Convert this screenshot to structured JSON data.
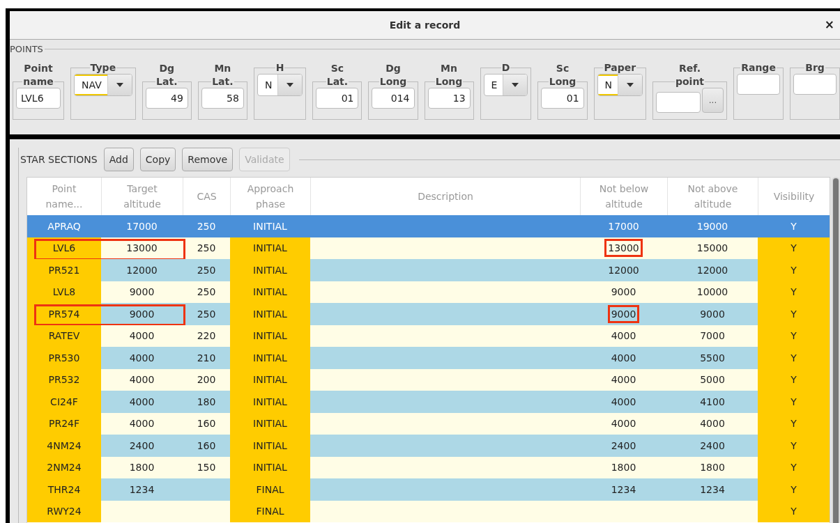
{
  "window": {
    "title": "Edit a record",
    "close": "×"
  },
  "points": {
    "title": "POINTS",
    "fields": [
      {
        "label_lines": [
          "Point",
          "name"
        ],
        "kind": "text",
        "value": "LVL6"
      },
      {
        "label_lines": [
          "Type"
        ],
        "kind": "combo",
        "value": "NAV",
        "highlighted": true
      },
      {
        "label_lines": [
          "Dg",
          "Lat."
        ],
        "kind": "number",
        "value": "49"
      },
      {
        "label_lines": [
          "Mn",
          "Lat."
        ],
        "kind": "number",
        "value": "58"
      },
      {
        "label_lines": [
          "H"
        ],
        "kind": "combo",
        "value": "N",
        "highlighted": false
      },
      {
        "label_lines": [
          "Sc",
          "Lat."
        ],
        "kind": "number",
        "value": "01"
      },
      {
        "label_lines": [
          "Dg",
          "Long"
        ],
        "kind": "number",
        "value": "014"
      },
      {
        "label_lines": [
          "Mn",
          "Long"
        ],
        "kind": "number",
        "value": "13"
      },
      {
        "label_lines": [
          "D"
        ],
        "kind": "combo",
        "value": "E",
        "highlighted": false
      },
      {
        "label_lines": [
          "Sc",
          "Long"
        ],
        "kind": "number",
        "value": "01"
      },
      {
        "label_lines": [
          "Paper"
        ],
        "kind": "combo",
        "value": "N",
        "highlighted": true
      },
      {
        "label_lines": [
          "Ref.",
          "point"
        ],
        "kind": "picker",
        "button": "..."
      },
      {
        "label_lines": [
          "Range"
        ],
        "kind": "number"
      },
      {
        "label_lines": [
          "Brg"
        ],
        "kind": "number"
      }
    ]
  },
  "star_sections": {
    "title": "STAR SECTIONS",
    "buttons": [
      {
        "label": "Add",
        "disabled": false
      },
      {
        "label": "Copy",
        "disabled": false
      },
      {
        "label": "Remove",
        "disabled": false
      },
      {
        "label": "Validate",
        "disabled": true
      }
    ],
    "table": {
      "columns": [
        [
          "Point",
          "name..."
        ],
        [
          "Target",
          "altitude"
        ],
        [
          "CAS"
        ],
        [
          "Approach",
          "phase"
        ],
        [
          "Description"
        ],
        [
          "Not below",
          "altitude"
        ],
        [
          "Not above",
          "altitude"
        ],
        [
          "Visibility"
        ]
      ],
      "rows": [
        {
          "name": "APRAQ",
          "target": "17000",
          "cas": "250",
          "phase": "INITIAL",
          "not_below": "17000",
          "not_above": "19000",
          "visibility": "Y",
          "selected": true,
          "highlighted": false
        },
        {
          "name": "LVL6",
          "target": "13000",
          "cas": "250",
          "phase": "INITIAL",
          "not_below": "13000",
          "not_above": "15000",
          "visibility": "Y",
          "selected": false,
          "highlighted": true
        },
        {
          "name": "PR521",
          "target": "12000",
          "cas": "250",
          "phase": "INITIAL",
          "not_below": "12000",
          "not_above": "12000",
          "visibility": "Y",
          "selected": false,
          "highlighted": false
        },
        {
          "name": "LVL8",
          "target": "9000",
          "cas": "250",
          "phase": "INITIAL",
          "not_below": "9000",
          "not_above": "10000",
          "visibility": "Y",
          "selected": false,
          "highlighted": false
        },
        {
          "name": "PR574",
          "target": "9000",
          "cas": "250",
          "phase": "INITIAL",
          "not_below": "9000",
          "not_above": "9000",
          "visibility": "Y",
          "selected": false,
          "highlighted": true
        },
        {
          "name": "RATEV",
          "target": "4000",
          "cas": "220",
          "phase": "INITIAL",
          "not_below": "4000",
          "not_above": "7000",
          "visibility": "Y",
          "selected": false,
          "highlighted": false
        },
        {
          "name": "PR530",
          "target": "4000",
          "cas": "210",
          "phase": "INITIAL",
          "not_below": "4000",
          "not_above": "5500",
          "visibility": "Y",
          "selected": false,
          "highlighted": false
        },
        {
          "name": "PR532",
          "target": "4000",
          "cas": "200",
          "phase": "INITIAL",
          "not_below": "4000",
          "not_above": "5000",
          "visibility": "Y",
          "selected": false,
          "highlighted": false
        },
        {
          "name": "CI24F",
          "target": "4000",
          "cas": "180",
          "phase": "INITIAL",
          "not_below": "4000",
          "not_above": "4100",
          "visibility": "Y",
          "selected": false,
          "highlighted": false
        },
        {
          "name": "PR24F",
          "target": "4000",
          "cas": "160",
          "phase": "INITIAL",
          "not_below": "4000",
          "not_above": "4000",
          "visibility": "Y",
          "selected": false,
          "highlighted": false
        },
        {
          "name": "4NM24",
          "target": "2400",
          "cas": "160",
          "phase": "INITIAL",
          "not_below": "2400",
          "not_above": "2400",
          "visibility": "Y",
          "selected": false,
          "highlighted": false
        },
        {
          "name": "2NM24",
          "target": "1800",
          "cas": "150",
          "phase": "INITIAL",
          "not_below": "1800",
          "not_above": "1800",
          "visibility": "Y",
          "selected": false,
          "highlighted": false
        },
        {
          "name": "THR24",
          "target": "1234",
          "phase": "FINAL",
          "not_below": "1234",
          "not_above": "1234",
          "visibility": "Y",
          "selected": false,
          "highlighted": false
        },
        {
          "name": "RWY24",
          "phase": "FINAL",
          "visibility": "Y",
          "selected": false,
          "highlighted": false
        }
      ]
    }
  }
}
